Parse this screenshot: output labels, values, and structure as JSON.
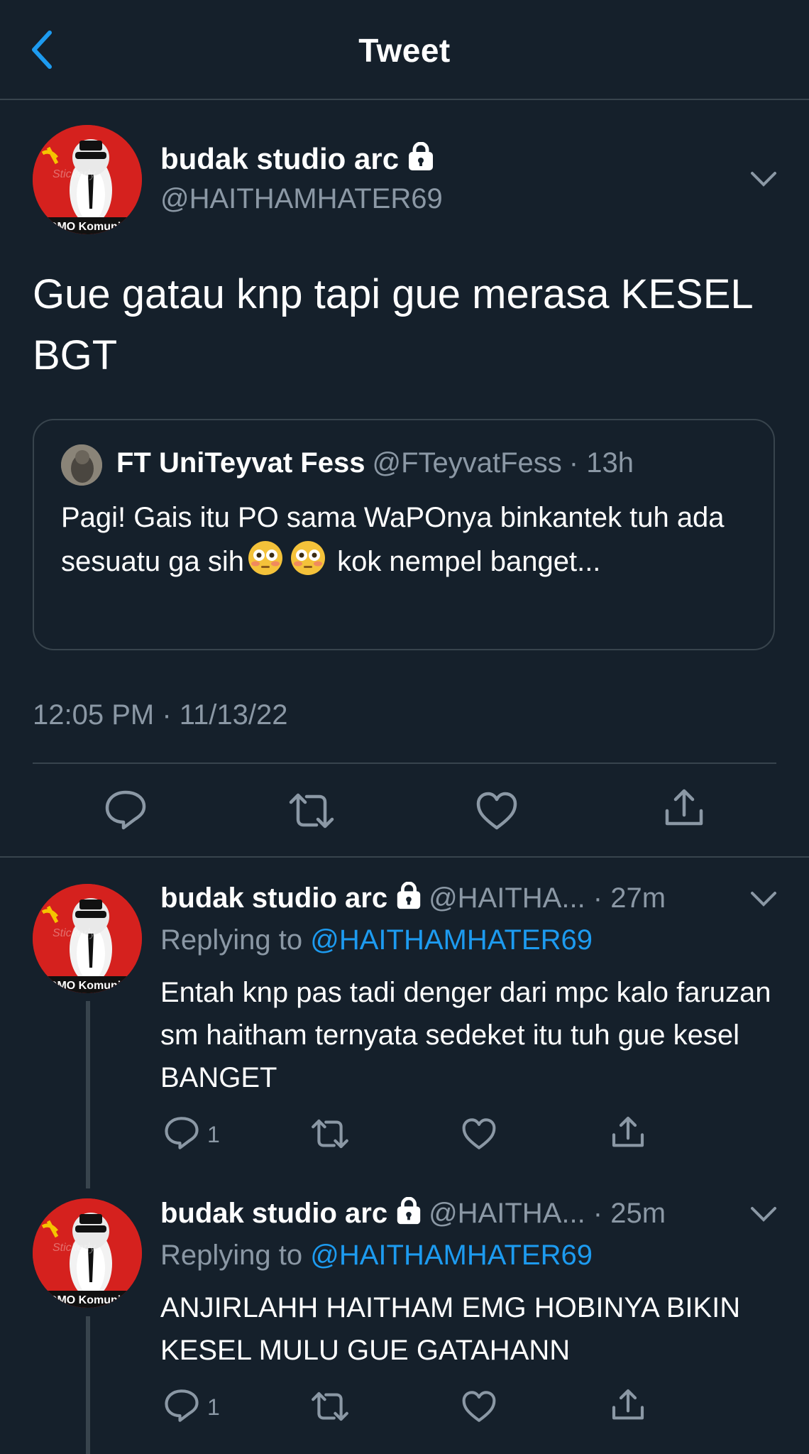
{
  "header": {
    "title": "Tweet"
  },
  "tweet": {
    "name": "budak studio arc",
    "handle": "@HAITHAMHATER69",
    "text": "Gue gatau knp tapi gue merasa KESEL BGT",
    "timestamp": "12:05 PM · 11/13/22"
  },
  "quote": {
    "name": "FT UniTeyvat Fess",
    "handle": "@FTeyvatFess",
    "time": "· 13h",
    "text_part1": "Pagi! Gais itu PO sama WaPOnya binkantek tuh ada sesuatu ga sih",
    "text_part2": " kok nempel banget..."
  },
  "avatar": {
    "text": "OMO Komuni",
    "overlay": "Stickerly"
  },
  "replies": [
    {
      "name": "budak studio arc",
      "meta": "@HAITHA... · 27m",
      "replying_label": "Replying to",
      "mention": "@HAITHAMHATER69",
      "text": "Entah knp pas tadi denger dari mpc kalo faruzan sm haitham ternyata sedeket itu tuh gue kesel BANGET",
      "reply_count": "1"
    },
    {
      "name": "budak studio arc",
      "meta": "@HAITHA... · 25m",
      "replying_label": "Replying to",
      "mention": "@HAITHAMHATER69",
      "text": "ANJIRLAHH HAITHAM EMG HOBINYA BIKIN KESEL MULU GUE GATAHANN",
      "reply_count": "1"
    }
  ],
  "icons": {
    "back": "chevron-left-icon",
    "lock": "lock-icon",
    "more": "chevron-down-icon",
    "reply": "reply-icon",
    "retweet": "retweet-icon",
    "like": "heart-icon",
    "share": "share-icon"
  },
  "colors": {
    "background": "#15202b",
    "accent": "#1d9bf0",
    "muted": "#8b98a5",
    "divider": "#38444d"
  }
}
